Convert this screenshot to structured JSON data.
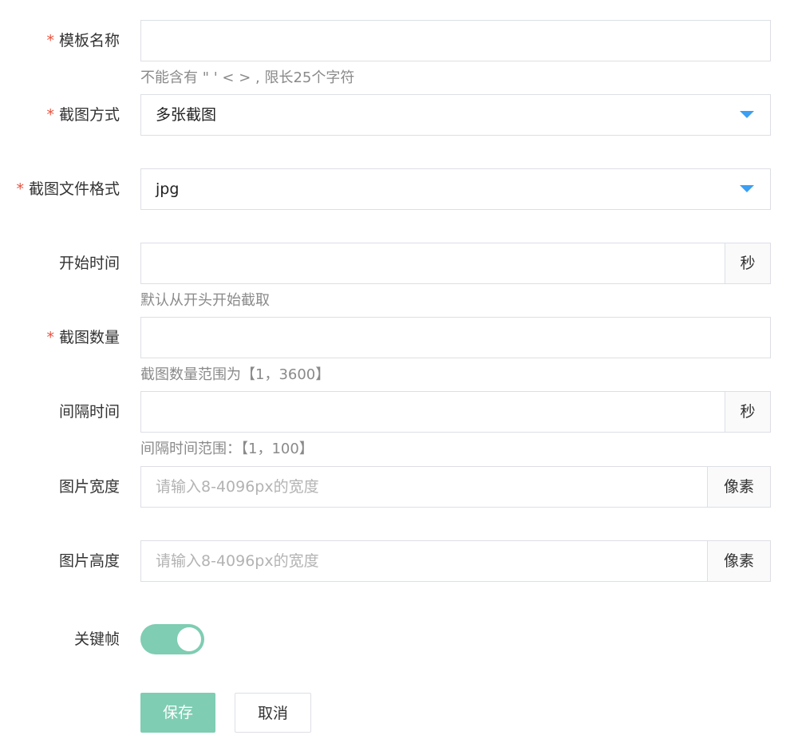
{
  "form": {
    "template_name": {
      "label": "模板名称",
      "required": true,
      "value": "",
      "hint": "不能含有 \" ' < > , 限长25个字符"
    },
    "capture_mode": {
      "label": "截图方式",
      "required": true,
      "value": "多张截图"
    },
    "file_format": {
      "label": "截图文件格式",
      "required": true,
      "value": "jpg"
    },
    "start_time": {
      "label": "开始时间",
      "required": false,
      "value": "",
      "unit": "秒",
      "hint": "默认从开头开始截取"
    },
    "capture_count": {
      "label": "截图数量",
      "required": true,
      "value": "",
      "hint": "截图数量范围为【1，3600】"
    },
    "interval": {
      "label": "间隔时间",
      "required": false,
      "value": "",
      "unit": "秒",
      "hint": "间隔时间范围：【1，100】"
    },
    "width": {
      "label": "图片宽度",
      "placeholder": "请输入8-4096px的宽度",
      "unit": "像素"
    },
    "height": {
      "label": "图片高度",
      "placeholder": "请输入8-4096px的宽度",
      "unit": "像素"
    },
    "keyframe": {
      "label": "关键帧",
      "on": true
    }
  },
  "required_mark": "*",
  "buttons": {
    "save": "保存",
    "cancel": "取消"
  },
  "colors": {
    "accent": "#7fcdb3",
    "required": "#e8523f",
    "caret": "#3b9ff3"
  }
}
